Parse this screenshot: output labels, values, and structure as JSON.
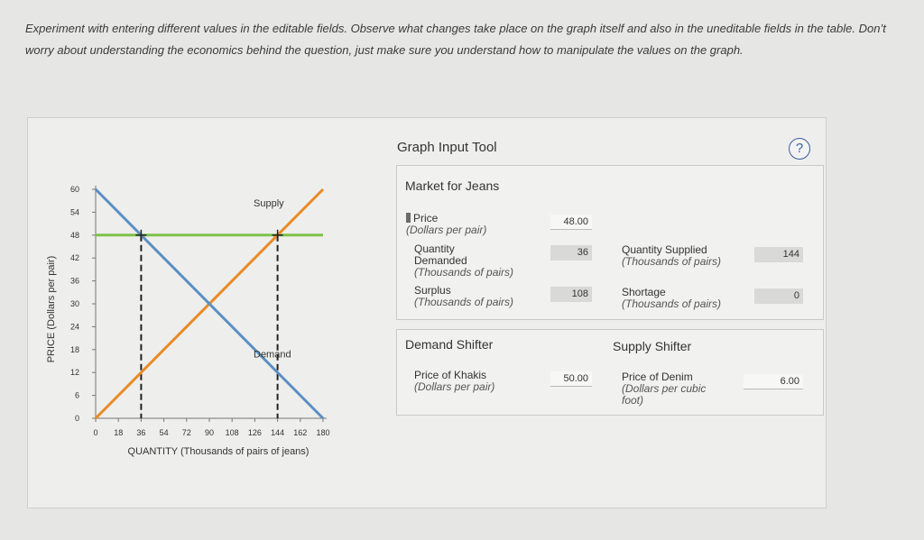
{
  "instructions": "Experiment with entering different values in the editable fields. Observe what changes take place on the graph itself and also in the uneditable fields in the table. Don’t worry about understanding the economics behind the question, just make sure you understand how to manipulate the values on the graph.",
  "tool": {
    "title": "Graph Input Tool",
    "help_label": "?"
  },
  "market": {
    "title": "Market for Jeans",
    "price_label": "Price",
    "price_unit": "(Dollars per pair)",
    "price_value": "48.00",
    "qd_label_1": "Quantity",
    "qd_label_2": "Demanded",
    "qd_unit": "(Thousands of pairs)",
    "qd_value": "36",
    "qs_label": "Quantity Supplied",
    "qs_unit": "(Thousands of pairs)",
    "qs_value": "144",
    "surplus_label": "Surplus",
    "surplus_unit": "(Thousands of pairs)",
    "surplus_value": "108",
    "shortage_label": "Shortage",
    "shortage_unit": "(Thousands of pairs)",
    "shortage_value": "0"
  },
  "demand_shifter": {
    "title": "Demand Shifter",
    "label": "Price of Khakis",
    "unit": "(Dollars per pair)",
    "value": "50.00"
  },
  "supply_shifter": {
    "title": "Supply Shifter",
    "label": "Price of Denim",
    "unit_1": "(Dollars per cubic",
    "unit_2": "foot)",
    "value": "6.00"
  },
  "colors": {
    "demand": "#5b8fc4",
    "supply": "#ea8a25",
    "price": "#7dc24a",
    "help": "#3b5f9a"
  },
  "chart_data": {
    "type": "line",
    "xlabel": "QUANTITY (Thousands of pairs of jeans)",
    "ylabel": "PRICE (Dollars per pair)",
    "xlim": [
      0,
      180
    ],
    "ylim": [
      0,
      60
    ],
    "xticks": [
      0,
      18,
      36,
      54,
      72,
      90,
      108,
      126,
      144,
      162,
      180
    ],
    "yticks": [
      0,
      6,
      12,
      18,
      24,
      30,
      36,
      42,
      48,
      54,
      60
    ],
    "series": [
      {
        "name": "Supply",
        "x": [
          0,
          180
        ],
        "y": [
          0,
          60
        ]
      },
      {
        "name": "Demand",
        "x": [
          0,
          180
        ],
        "y": [
          60,
          0
        ]
      }
    ],
    "price_line": 48,
    "quantity_demanded": 36,
    "quantity_supplied": 144
  }
}
